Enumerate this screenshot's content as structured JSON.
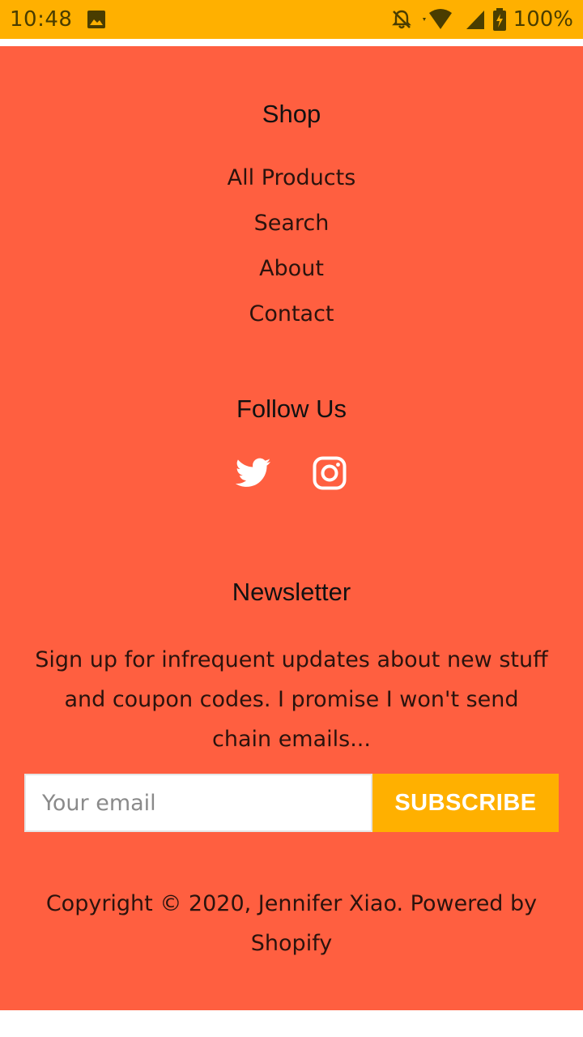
{
  "status_bar": {
    "time": "10:48",
    "battery": "100%",
    "background": "#FFB000"
  },
  "footer": {
    "background": "#FF5F40",
    "shop": {
      "title": "Shop",
      "links": [
        "All Products",
        "Search",
        "About",
        "Contact"
      ]
    },
    "follow": {
      "title": "Follow Us",
      "icons": [
        "twitter-icon",
        "instagram-icon"
      ]
    },
    "newsletter": {
      "title": "Newsletter",
      "description": "Sign up for infrequent updates about new stuff and coupon codes. I promise I won't send chain emails...",
      "email_placeholder": "Your email",
      "subscribe_label": "SUBSCRIBE",
      "subscribe_color": "#FFB000"
    },
    "copyright": "Copyright © 2020, Jennifer Xiao. Powered by Shopify"
  }
}
